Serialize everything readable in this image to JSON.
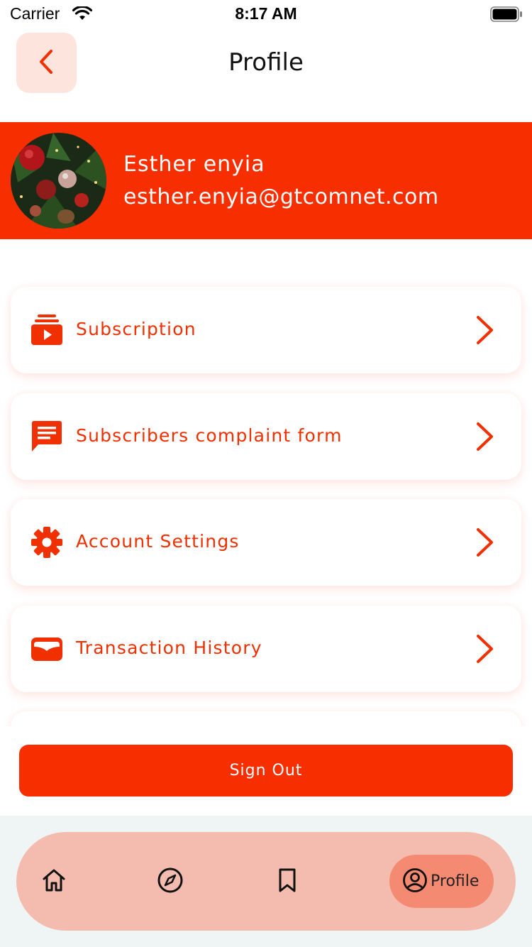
{
  "status_bar": {
    "carrier": "Carrier",
    "time": "8:17 AM"
  },
  "header": {
    "title": "Profile",
    "back_icon": "chevron-left-icon"
  },
  "profile": {
    "name": "Esther enyia",
    "email": "esther.enyia@gtcomnet.com",
    "avatar": "christmas-tree-ornaments-photo"
  },
  "menu": {
    "items": [
      {
        "label": "Subscription",
        "icon": "subscriptions-icon"
      },
      {
        "label": "Subscribers complaint form",
        "icon": "feedback-message-icon"
      },
      {
        "label": "Account Settings",
        "icon": "gear-icon"
      },
      {
        "label": "Transaction History",
        "icon": "wallet-icon"
      }
    ]
  },
  "sign_out_label": "Sign Out",
  "bottom_nav": {
    "items": [
      {
        "icon": "home-icon"
      },
      {
        "icon": "compass-icon"
      },
      {
        "icon": "bookmark-icon"
      }
    ],
    "active": {
      "label": "Profile",
      "icon": "account-circle-icon"
    }
  },
  "colors": {
    "accent": "#f72e00",
    "menu_text": "#f03000",
    "nav_background": "#f4bcaf",
    "nav_active": "#f58a72",
    "back_button_bg": "#fde4dc"
  }
}
